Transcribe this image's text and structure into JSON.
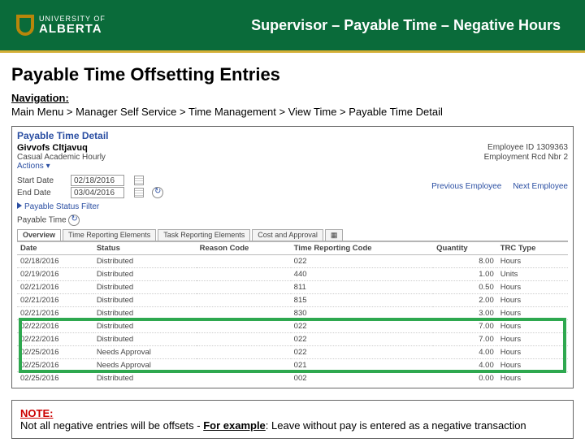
{
  "header": {
    "logo_top": "UNIVERSITY OF",
    "logo_bottom": "ALBERTA",
    "slide_title": "Supervisor – Payable Time – Negative Hours"
  },
  "page": {
    "title": "Payable Time Offsetting Entries",
    "nav_label": "Navigation:",
    "nav_path": "Main Menu > Manager Self Service > Time Management > View Time > Payable Time Detail"
  },
  "screenshot": {
    "section_title": "Payable Time Detail",
    "employee_name": "Givvofs Cltjavuq",
    "employee_id_label": "Employee ID",
    "employee_id": "1309363",
    "job_label": "Casual Academic Hourly",
    "rcd_label": "Employment Rcd Nbr",
    "rcd_value": "2",
    "actions": "Actions ▾",
    "start_date_label": "Start Date",
    "start_date": "02/18/2016",
    "end_date_label": "End Date",
    "end_date": "03/04/2016",
    "prev_emp": "Previous Employee",
    "next_emp": "Next Employee",
    "filter_label": "Payable Status Filter",
    "payable_time_label": "Payable Time",
    "tabs": [
      "Overview",
      "Time Reporting Elements",
      "Task Reporting Elements",
      "Cost and Approval"
    ],
    "cols": [
      "Date",
      "Status",
      "Reason Code",
      "Time Reporting Code",
      "Quantity",
      "TRC Type"
    ],
    "rows": [
      {
        "date": "02/18/2016",
        "status": "Distributed",
        "reason": "",
        "trc": "022",
        "qty": "8.00",
        "type": "Hours"
      },
      {
        "date": "02/19/2016",
        "status": "Distributed",
        "reason": "",
        "trc": "440",
        "qty": "1.00",
        "type": "Units"
      },
      {
        "date": "02/21/2016",
        "status": "Distributed",
        "reason": "",
        "trc": "811",
        "qty": "0.50",
        "type": "Hours"
      },
      {
        "date": "02/21/2016",
        "status": "Distributed",
        "reason": "",
        "trc": "815",
        "qty": "2.00",
        "type": "Hours"
      },
      {
        "date": "02/21/2016",
        "status": "Distributed",
        "reason": "",
        "trc": "830",
        "qty": "3.00",
        "type": "Hours"
      },
      {
        "date": "02/22/2016",
        "status": "Distributed",
        "reason": "",
        "trc": "022",
        "qty": "7.00",
        "type": "Hours"
      },
      {
        "date": "02/22/2016",
        "status": "Distributed",
        "reason": "",
        "trc": "022",
        "qty": "7.00",
        "type": "Hours"
      },
      {
        "date": "02/25/2016",
        "status": "Needs Approval",
        "reason": "",
        "trc": "022",
        "qty": "4.00",
        "type": "Hours"
      },
      {
        "date": "02/25/2016",
        "status": "Needs Approval",
        "reason": "",
        "trc": "021",
        "qty": "4.00",
        "type": "Hours"
      },
      {
        "date": "02/25/2016",
        "status": "Distributed",
        "reason": "",
        "trc": "002",
        "qty": "0.00",
        "type": "Hours"
      }
    ]
  },
  "note": {
    "label": "NOTE:",
    "text_a": "Not all negative entries will be offsets - ",
    "for_example": "For example",
    "text_b": ": Leave without pay is entered as a negative transaction"
  }
}
